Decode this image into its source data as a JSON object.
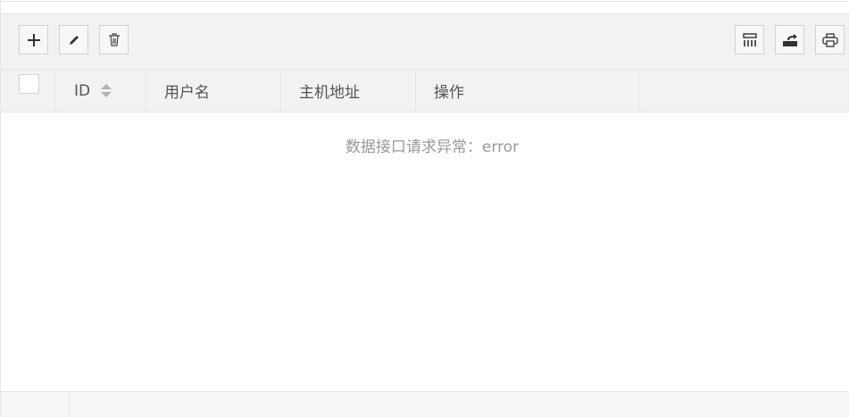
{
  "toolbar": {
    "add_icon": "plus-icon",
    "edit_icon": "pencil-icon",
    "delete_icon": "trash-icon",
    "columns_icon": "columns-icon",
    "export_icon": "export-icon",
    "print_icon": "print-icon"
  },
  "table": {
    "columns": [
      {
        "label": "ID",
        "sortable": true
      },
      {
        "label": "用户名"
      },
      {
        "label": "主机地址"
      },
      {
        "label": "操作"
      }
    ],
    "empty_text": "数据接口请求异常：error"
  }
}
